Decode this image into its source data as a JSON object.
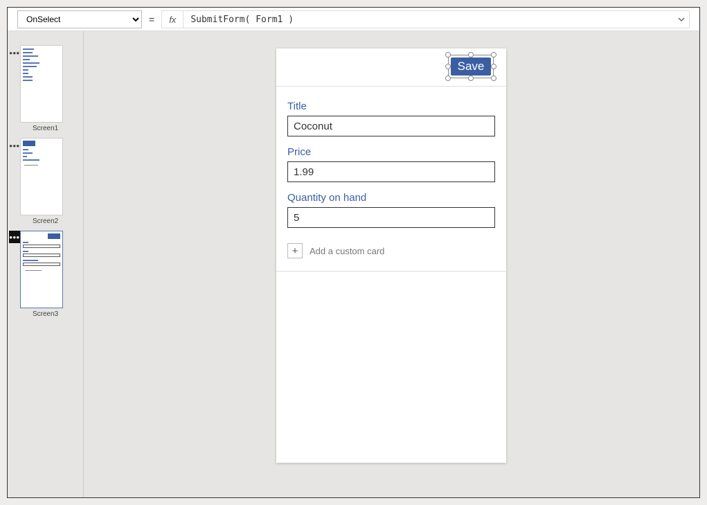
{
  "formula_bar": {
    "property": "OnSelect",
    "equals": "=",
    "fx": "fx",
    "expression": "SubmitForm( Form1 )"
  },
  "thumbs": {
    "screen1": "Screen1",
    "screen2": "Screen2",
    "screen3": "Screen3"
  },
  "canvas": {
    "save_label": "Save",
    "fields": {
      "title_label": "Title",
      "title_value": "Coconut",
      "price_label": "Price",
      "price_value": "1.99",
      "qty_label": "Quantity on hand",
      "qty_value": "5"
    },
    "add_custom_card": "Add a custom card",
    "plus": "+"
  }
}
